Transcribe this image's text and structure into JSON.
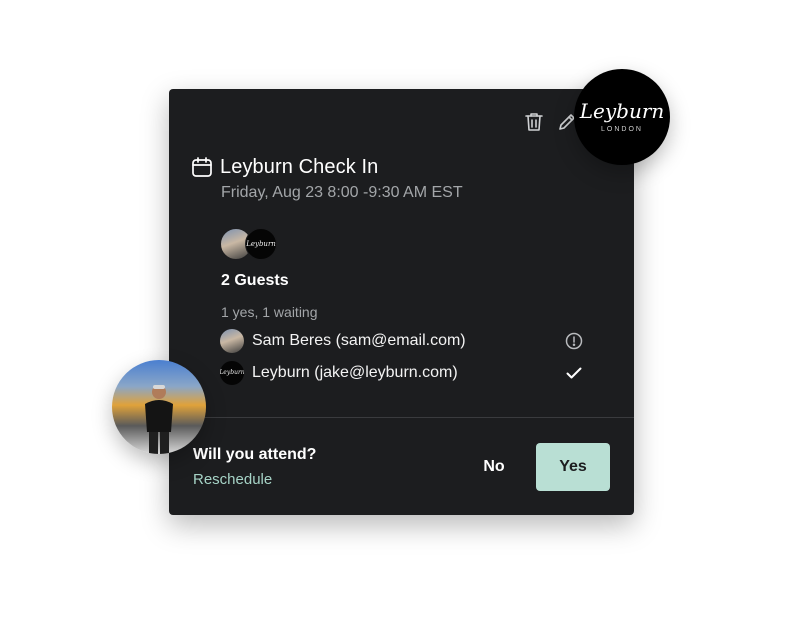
{
  "event": {
    "title": "Leyburn Check In",
    "datetime": "Friday, Aug 23 8:00 -9:30 AM EST"
  },
  "toolbar": {
    "delete_icon": "trash-icon",
    "edit_icon": "pencil-icon"
  },
  "guests": {
    "count_label": "2 Guests",
    "summary": "1 yes, 1 waiting",
    "list": [
      {
        "name": "Sam Beres (sam@email.com)",
        "status": "waiting",
        "status_icon": "alert-circle-icon"
      },
      {
        "name": "Leyburn (jake@leyburn.com)",
        "status": "yes",
        "status_icon": "check-icon"
      }
    ]
  },
  "rsvp": {
    "question": "Will you attend?",
    "reschedule": "Reschedule",
    "no_label": "No",
    "yes_label": "Yes"
  },
  "brand": {
    "name": "Leyburn",
    "location": "LONDON"
  },
  "colors": {
    "card_bg": "#1c1d1f",
    "accent": "#b9dfd4",
    "link": "#a6d3c6",
    "muted_text": "#a3a6a9"
  }
}
